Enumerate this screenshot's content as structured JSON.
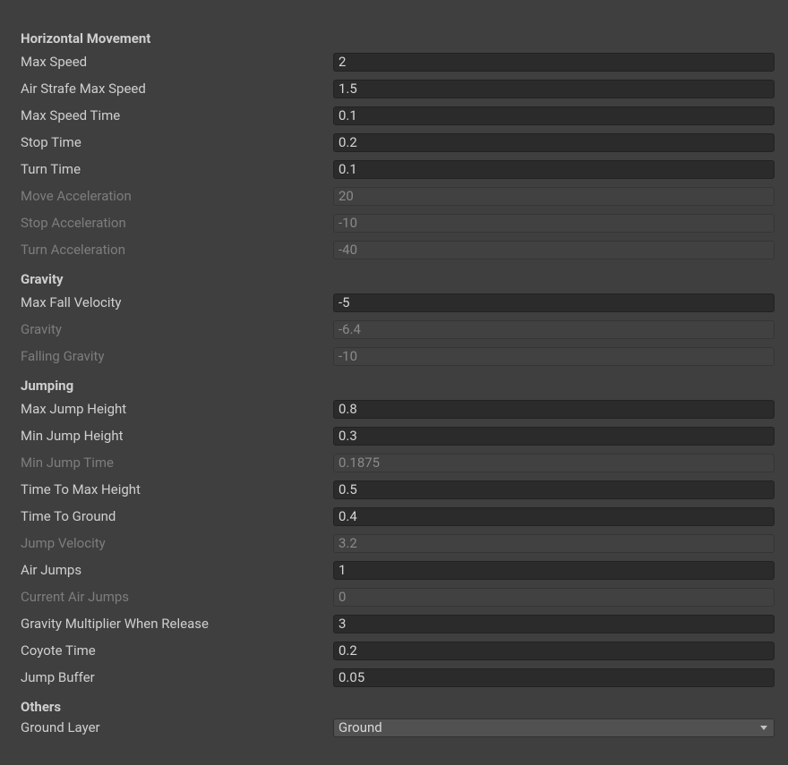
{
  "sections": {
    "horizontal": {
      "title": "Horizontal Movement",
      "fields": {
        "maxSpeed": {
          "label": "Max Speed",
          "value": "2"
        },
        "airStrafe": {
          "label": "Air Strafe Max Speed",
          "value": "1.5"
        },
        "maxSpeedTime": {
          "label": "Max Speed Time",
          "value": "0.1"
        },
        "stopTime": {
          "label": "Stop Time",
          "value": "0.2"
        },
        "turnTime": {
          "label": "Turn Time",
          "value": "0.1"
        },
        "moveAccel": {
          "label": "Move Acceleration",
          "value": "20"
        },
        "stopAccel": {
          "label": "Stop Acceleration",
          "value": "-10"
        },
        "turnAccel": {
          "label": "Turn Acceleration",
          "value": "-40"
        }
      }
    },
    "gravity": {
      "title": "Gravity",
      "fields": {
        "maxFallVel": {
          "label": "Max Fall Velocity",
          "value": "-5"
        },
        "gravity": {
          "label": "Gravity",
          "value": "-6.4"
        },
        "fallingGravity": {
          "label": "Falling Gravity",
          "value": "-10"
        }
      }
    },
    "jumping": {
      "title": "Jumping",
      "fields": {
        "maxJumpHeight": {
          "label": "Max Jump Height",
          "value": "0.8"
        },
        "minJumpHeight": {
          "label": "Min Jump Height",
          "value": "0.3"
        },
        "minJumpTime": {
          "label": "Min Jump Time",
          "value": "0.1875"
        },
        "timeToMaxHeight": {
          "label": "Time To Max Height",
          "value": "0.5"
        },
        "timeToGround": {
          "label": "Time To Ground",
          "value": "0.4"
        },
        "jumpVelocity": {
          "label": "Jump Velocity",
          "value": "3.2"
        },
        "airJumps": {
          "label": "Air Jumps",
          "value": "1"
        },
        "currentAirJumps": {
          "label": "Current Air Jumps",
          "value": "0"
        },
        "gravityMultRelease": {
          "label": "Gravity Multiplier When Release",
          "value": "3"
        },
        "coyoteTime": {
          "label": "Coyote Time",
          "value": "0.2"
        },
        "jumpBuffer": {
          "label": "Jump Buffer",
          "value": "0.05"
        }
      }
    },
    "others": {
      "title": "Others",
      "fields": {
        "groundLayer": {
          "label": "Ground Layer",
          "value": "Ground"
        }
      }
    }
  }
}
